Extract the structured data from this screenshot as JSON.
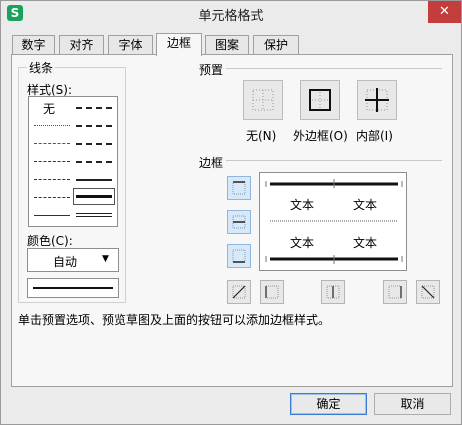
{
  "window": {
    "title": "单元格格式",
    "app_icon_letter": "S",
    "close_glyph": "✕"
  },
  "tabs": [
    {
      "label": "数字"
    },
    {
      "label": "对齐"
    },
    {
      "label": "字体"
    },
    {
      "label": "边框"
    },
    {
      "label": "图案"
    },
    {
      "label": "保护"
    }
  ],
  "active_tab": "边框",
  "line_group": {
    "title": "线条",
    "style_label": "样式(S):",
    "style_none": "无",
    "color_label": "颜色(C):",
    "color_value": "自动",
    "dropdown_glyph": "▼"
  },
  "presets": {
    "title": "预置",
    "items": [
      {
        "label": "无(N)"
      },
      {
        "label": "外边框(O)"
      },
      {
        "label": "内部(I)"
      }
    ]
  },
  "border": {
    "title": "边框",
    "preview_cells": [
      "文本",
      "文本",
      "文本",
      "文本"
    ]
  },
  "hint": "单击预置选项、预览草图及上面的按钮可以添加边框样式。",
  "buttons": {
    "ok": "确定",
    "cancel": "取消"
  },
  "colors": {
    "accent": "#3a7bd5",
    "close": "#c43d3d",
    "app_icon": "#1aa15a"
  }
}
